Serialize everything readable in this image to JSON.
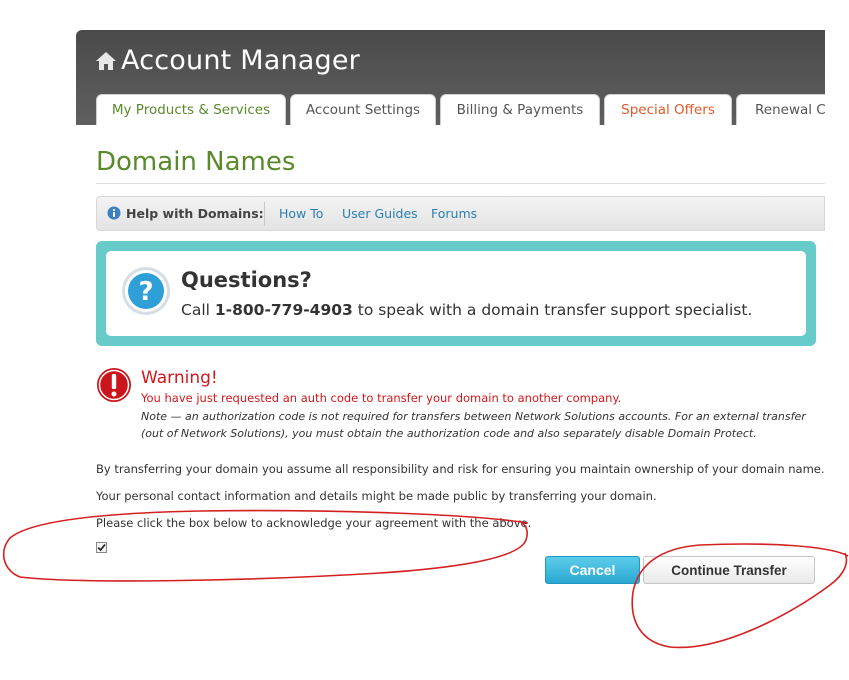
{
  "header": {
    "title": "Account Manager",
    "icon": "home-icon",
    "background": "#555555"
  },
  "tabs": [
    {
      "label": "My Products & Services",
      "active": true
    },
    {
      "label": "Account Settings"
    },
    {
      "label": "Billing & Payments"
    },
    {
      "label": "Special Offers",
      "color": "#e05a2a"
    },
    {
      "label": "Renewal Ce"
    }
  ],
  "page": {
    "title": "Domain Names",
    "title_color": "#5a8a2b"
  },
  "help": {
    "label": "Help with Domains:",
    "links": [
      "How To",
      "User Guides",
      "Forums"
    ],
    "icon": "info-icon"
  },
  "questions": {
    "title": "Questions?",
    "call_prefix": "Call ",
    "phone": "1-800-779-4903",
    "call_suffix": " to speak with a domain transfer support specialist.",
    "border_color": "#67cbca",
    "icon": "question-icon"
  },
  "warning": {
    "title": "Warning!",
    "text": "You have just requested an auth code to transfer your domain to another company.",
    "note": "Note — an authorization code is not required for transfers between Network Solutions accounts. For an external transfer (out of Network Solutions), you must obtain the authorization code and also separately disable Domain Protect.",
    "color": "#d0191c",
    "icon": "warning-icon"
  },
  "paragraphs": {
    "risk": "By transferring your domain you assume all responsibility and risk for ensuring you maintain ownership of your domain name.",
    "privacy": "Your personal contact information and details might be made public by transferring your domain.",
    "acknowledge": "Please click the box below to acknowledge your agreement with the above."
  },
  "agreement_checked": true,
  "buttons": {
    "cancel": "Cancel",
    "continue": "Continue Transfer"
  },
  "annotation_color": "#d42020"
}
